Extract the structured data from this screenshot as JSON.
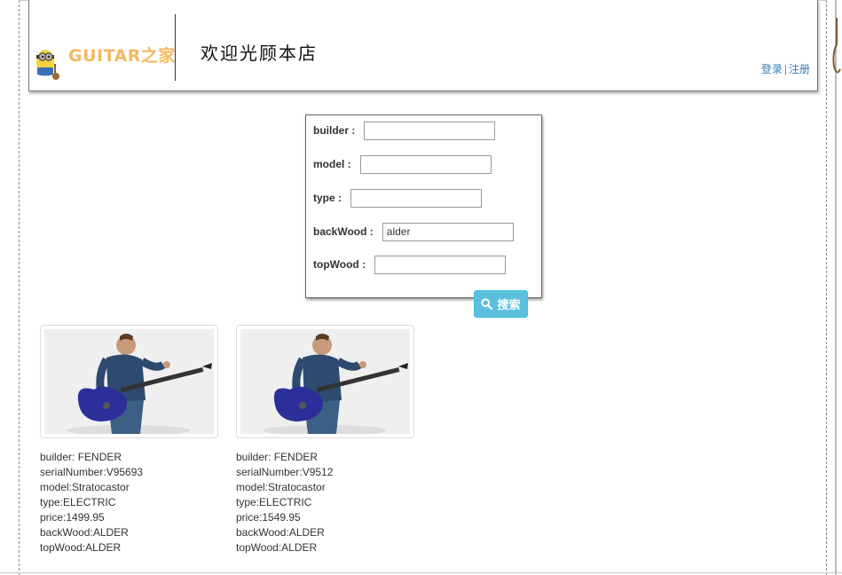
{
  "header": {
    "logo_text": "GUITAR之家",
    "welcome": "欢迎光顾本店",
    "login": "登录",
    "separator": "|",
    "register": "注册"
  },
  "search": {
    "fields": [
      {
        "label": "builder :",
        "value": ""
      },
      {
        "label": "model :",
        "value": ""
      },
      {
        "label": "type :",
        "value": ""
      },
      {
        "label": "backWood :",
        "value": "alder"
      },
      {
        "label": "topWood :",
        "value": ""
      }
    ],
    "button_label": "搜索"
  },
  "results": [
    {
      "builder": "builder: FENDER",
      "serial": "serialNumber:V95693",
      "model": "model:Stratocastor",
      "type": "type:ELECTRIC",
      "price": "price:1499.95",
      "backWood": "backWood:ALDER",
      "topWood": "topWood:ALDER"
    },
    {
      "builder": "builder: FENDER",
      "serial": "serialNumber:V9512",
      "model": "model:Stratocastor",
      "type": "type:ELECTRIC",
      "price": "price:1549.95",
      "backWood": "backWood:ALDER",
      "topWood": "topWood:ALDER"
    }
  ],
  "colors": {
    "accent_button": "#5bc0de",
    "link": "#337ab7",
    "logo": "#f4b860"
  }
}
